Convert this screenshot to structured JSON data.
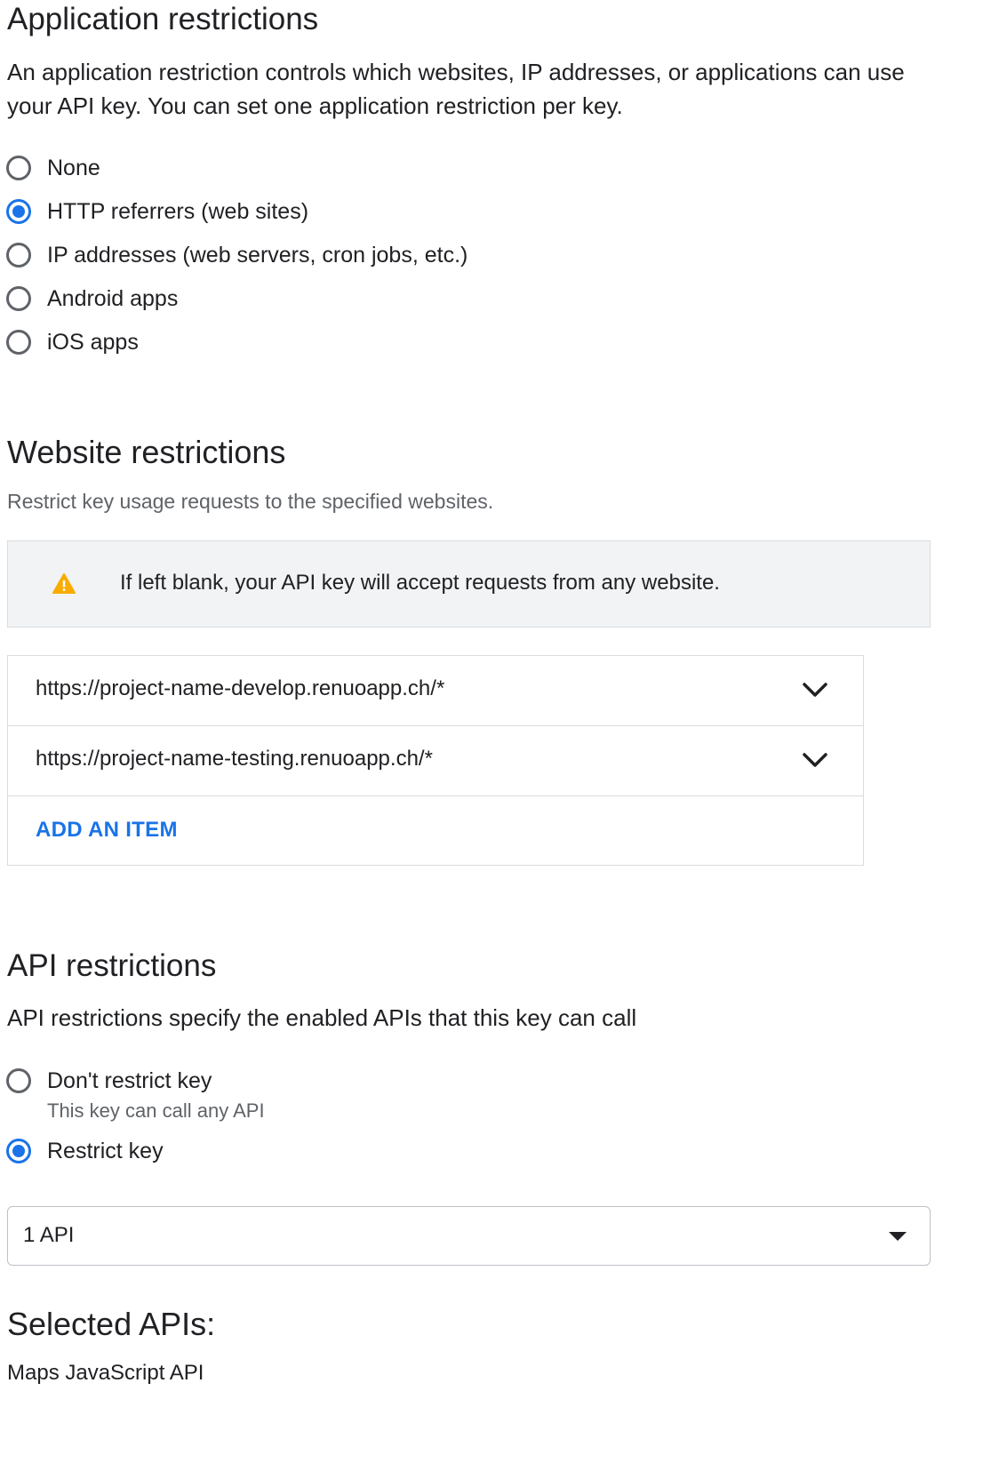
{
  "app_restrictions": {
    "title": "Application restrictions",
    "description": "An application restriction controls which websites, IP addresses, or applications can use your API key. You can set one application restriction per key.",
    "options": [
      {
        "label": "None",
        "selected": false
      },
      {
        "label": "HTTP referrers (web sites)",
        "selected": true
      },
      {
        "label": "IP addresses (web servers, cron jobs, etc.)",
        "selected": false
      },
      {
        "label": "Android apps",
        "selected": false
      },
      {
        "label": "iOS apps",
        "selected": false
      }
    ]
  },
  "website_restrictions": {
    "title": "Website restrictions",
    "description": "Restrict key usage requests to the specified websites.",
    "notice": {
      "icon": "warning-icon",
      "text": "If left blank, your API key will accept requests from any website."
    },
    "items": [
      {
        "value": "https://project-name-develop.renuoapp.ch/*"
      },
      {
        "value": "https://project-name-testing.renuoapp.ch/*"
      }
    ],
    "add_item_label": "ADD AN ITEM"
  },
  "api_restrictions": {
    "title": "API restrictions",
    "description": "API restrictions specify the enabled APIs that this key can call",
    "options": [
      {
        "label": "Don't restrict key",
        "sublabel": "This key can call any API",
        "selected": false
      },
      {
        "label": "Restrict key",
        "selected": true
      }
    ],
    "select_value": "1 API"
  },
  "selected_apis": {
    "title": "Selected APIs:",
    "items": [
      "Maps JavaScript API"
    ]
  },
  "colors": {
    "accent": "#1a73e8",
    "warning": "#f9ab00",
    "notice_bg": "#f1f3f4",
    "text": "#202124",
    "muted": "#5f6368"
  }
}
